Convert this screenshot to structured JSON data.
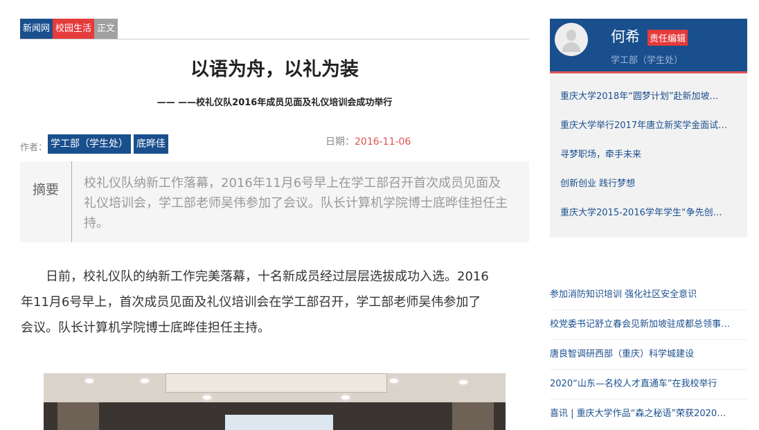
{
  "breadcrumb": [
    "新闻网",
    "校园生活",
    "正文"
  ],
  "article": {
    "title": "以语为舟，以礼为装",
    "subtitle": "—— ——校礼仪队2016年成员见面及礼仪培训会成功举行",
    "author_label": "作者：",
    "authors": [
      "学工部（学生处）",
      "底晔佳"
    ],
    "date_label": "日期：",
    "date": "2016-11-06",
    "abstract_label": "摘要",
    "abstract": "校礼仪队纳新工作落幕，2016年11月6号早上在学工部召开首次成员见面及礼仪培训会，学工部老师吴伟参加了会议。队长计算机学院博士底晔佳担任主持。",
    "body": "日前，校礼仪队的纳新工作完美落幕，十名新成员经过层层选拔成功入选。2016年11月6号早上，首次成员见面及礼仪培训会在学工部召开，学工部老师吴伟参加了会议。队长计算机学院博士底晔佳担任主持。"
  },
  "editor": {
    "name": "何希",
    "badge": "责任编辑",
    "dept": "学工部（学生处）"
  },
  "related": [
    "重庆大学2018年“圆梦计划”赴新加坡…",
    "重庆大学举行2017年唐立新奖学金面试…",
    "寻梦职场，牵手未来",
    "创新创业 践行梦想",
    "重庆大学2015-2016学年学生“争先创…"
  ],
  "news": [
    "参加消防知识培训 强化社区安全意识",
    "校党委书记舒立春会见新加坡驻成都总领事…",
    "唐良智调研西部（重庆）科学城建设",
    "2020“山东—名校人才直通车”在我校举行",
    "喜讯 | 重庆大学作品“森之秘语”荣获2020…"
  ],
  "colors": {
    "brand_blue": "#1a4f8e",
    "accent_red": "#e53b3b",
    "date_red": "#e05252"
  }
}
